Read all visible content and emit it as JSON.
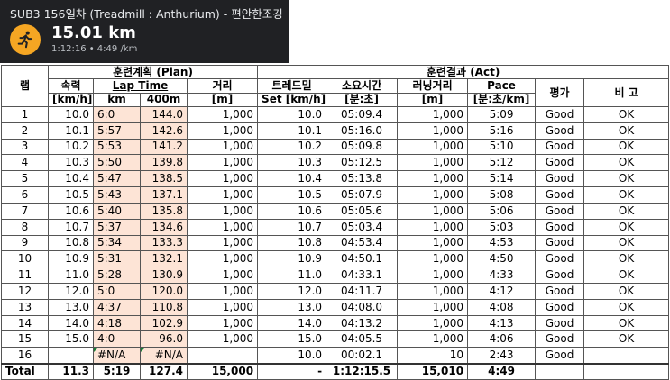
{
  "card": {
    "title": "SUB3 156일차 (Treadmill : Anthurium) - 편안한조깅",
    "distance": "15.01 km",
    "sub": "1:12:16 • 4:49 /km",
    "icon": "runner-icon",
    "accent": "#f5a623"
  },
  "table": {
    "col_lap": "랩",
    "group_plan": "훈련계획 (Plan)",
    "group_act": "훈련결과 (Act)",
    "speed_label": "속력",
    "speed_unit": "[km/h]",
    "laptime_label": "Lap Time",
    "km_label": "km",
    "m400_label": "400m",
    "dist_label": "거리",
    "dist_unit": "[m]",
    "tm_label": "트레드밀",
    "tm_unit": "Set [km/h]",
    "time_label": "소요시간",
    "time_unit": "[분:초]",
    "run_label": "러닝거리",
    "run_unit": "[m]",
    "pace_label": "Pace",
    "pace_unit": "[분:초/km]",
    "eval_label": "평가",
    "note_label": "비 고",
    "rows": [
      [
        "1",
        "10.0",
        "6:0",
        "144.0",
        "1,000",
        "10.0",
        "05:09.4",
        "1,000",
        "5:09",
        "Good",
        "OK"
      ],
      [
        "2",
        "10.1",
        "5:57",
        "142.6",
        "1,000",
        "10.1",
        "05:16.0",
        "1,000",
        "5:16",
        "Good",
        "OK"
      ],
      [
        "3",
        "10.2",
        "5:53",
        "141.2",
        "1,000",
        "10.2",
        "05:09.8",
        "1,000",
        "5:10",
        "Good",
        "OK"
      ],
      [
        "4",
        "10.3",
        "5:50",
        "139.8",
        "1,000",
        "10.3",
        "05:12.5",
        "1,000",
        "5:12",
        "Good",
        "OK"
      ],
      [
        "5",
        "10.4",
        "5:47",
        "138.5",
        "1,000",
        "10.4",
        "05:13.8",
        "1,000",
        "5:14",
        "Good",
        "OK"
      ],
      [
        "6",
        "10.5",
        "5:43",
        "137.1",
        "1,000",
        "10.5",
        "05:07.9",
        "1,000",
        "5:08",
        "Good",
        "OK"
      ],
      [
        "7",
        "10.6",
        "5:40",
        "135.8",
        "1,000",
        "10.6",
        "05:05.6",
        "1,000",
        "5:06",
        "Good",
        "OK"
      ],
      [
        "8",
        "10.7",
        "5:37",
        "134.6",
        "1,000",
        "10.7",
        "05:03.4",
        "1,000",
        "5:03",
        "Good",
        "OK"
      ],
      [
        "9",
        "10.8",
        "5:34",
        "133.3",
        "1,000",
        "10.8",
        "04:53.4",
        "1,000",
        "4:53",
        "Good",
        "OK"
      ],
      [
        "10",
        "10.9",
        "5:31",
        "132.1",
        "1,000",
        "10.9",
        "04:50.1",
        "1,000",
        "4:50",
        "Good",
        "OK"
      ],
      [
        "11",
        "11.0",
        "5:28",
        "130.9",
        "1,000",
        "11.0",
        "04:33.1",
        "1,000",
        "4:33",
        "Good",
        "OK"
      ],
      [
        "12",
        "12.0",
        "5:0",
        "120.0",
        "1,000",
        "12.0",
        "04:11.7",
        "1,000",
        "4:12",
        "Good",
        "OK"
      ],
      [
        "13",
        "13.0",
        "4:37",
        "110.8",
        "1,000",
        "13.0",
        "04:08.0",
        "1,000",
        "4:08",
        "Good",
        "OK"
      ],
      [
        "14",
        "14.0",
        "4:18",
        "102.9",
        "1,000",
        "14.0",
        "04:13.2",
        "1,000",
        "4:13",
        "Good",
        "OK"
      ],
      [
        "15",
        "15.0",
        "4:0",
        "96.0",
        "1,000",
        "15.0",
        "04:05.5",
        "1,000",
        "4:06",
        "Good",
        "OK"
      ],
      [
        "16",
        "",
        "#N/A",
        "#N/A",
        "",
        "10.0",
        "00:02.1",
        "10",
        "2:43",
        "Good",
        ""
      ]
    ],
    "total": [
      "Total",
      "11.3",
      "5:19",
      "127.4",
      "15,000",
      "-",
      "1:12:15.5",
      "15,010",
      "4:49",
      "",
      ""
    ]
  }
}
